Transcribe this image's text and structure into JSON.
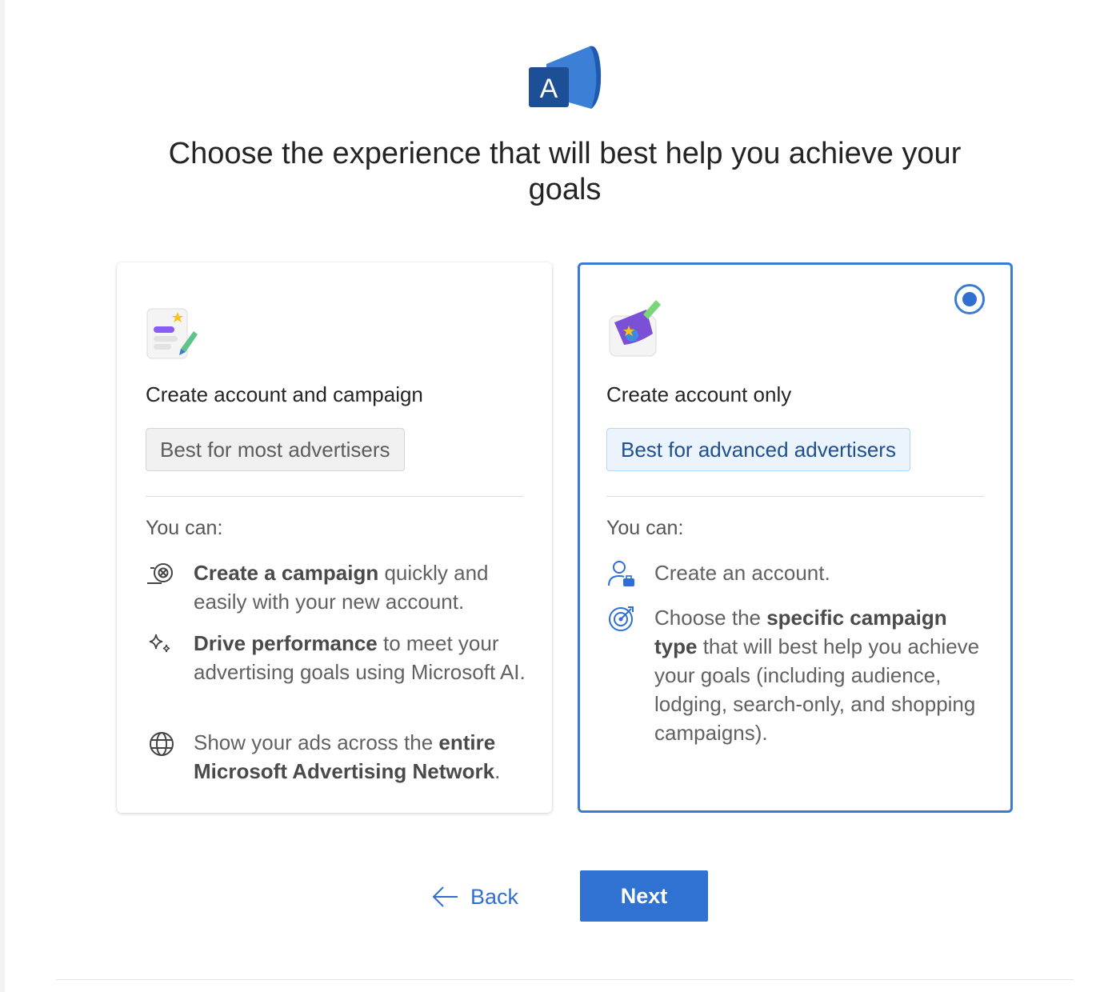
{
  "logo": {
    "letter": "A",
    "icon": "megaphone-logo-icon"
  },
  "title": "Choose the experience that will best help you achieve your goals",
  "options": [
    {
      "title": "Create account and campaign",
      "badge": "Best for most advertisers",
      "selected": false,
      "you_can": "You can:",
      "features": [
        {
          "icon": "speed-target-icon",
          "bold": "Create a campaign",
          "rest": " quickly and easily with your new account."
        },
        {
          "icon": "sparkle-icon",
          "bold": "Drive performance",
          "rest": " to meet your advertising goals using Microsoft AI."
        },
        {
          "icon": "globe-icon",
          "pre": "Show your ads across the ",
          "bold": "entire Microsoft Advertising Network",
          "rest": "."
        }
      ]
    },
    {
      "title": "Create account only",
      "badge": "Best for advanced advertisers",
      "selected": true,
      "you_can": "You can:",
      "features": [
        {
          "icon": "person-briefcase-icon",
          "text": "Create an account."
        },
        {
          "icon": "target-arrow-icon",
          "pre": "Choose the ",
          "bold": "specific campaign type",
          "rest": " that will best help you achieve your goals (including audience, lodging, search-only, and shopping campaigns)."
        }
      ]
    }
  ],
  "actions": {
    "back": "Back",
    "next": "Next"
  },
  "colors": {
    "accent": "#2f72d1",
    "selected_border": "#3a7bd5",
    "badge_blue_bg": "#ebf3fc"
  }
}
